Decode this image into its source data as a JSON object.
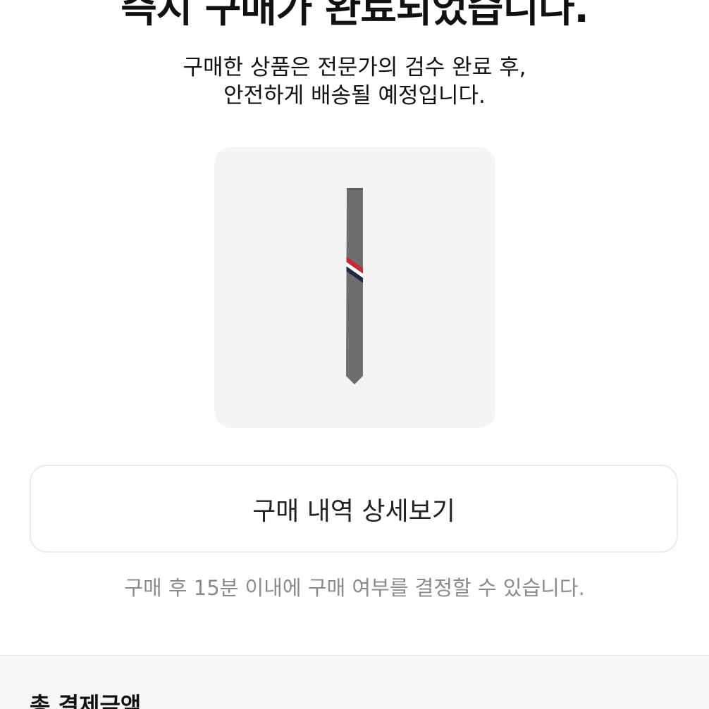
{
  "header": {
    "title": "즉시 구매가 완료되었습니다."
  },
  "message": {
    "line1": "구매한 상품은 전문가의 검수 완료 후,",
    "line2": "안전하게 배송될 예정입니다."
  },
  "product": {
    "image": "necktie-image",
    "colors": {
      "tie": "#6e6e6e",
      "stripe_red": "#c8283a",
      "stripe_white": "#ffffff",
      "stripe_navy": "#1e2a4a"
    }
  },
  "actions": {
    "detail_button_label": "구매 내역 상세보기"
  },
  "notice": {
    "text": "구매 후 15분 이내에 구매 여부를 결정할 수 있습니다."
  },
  "summary": {
    "total_label": "총 결제금액"
  }
}
